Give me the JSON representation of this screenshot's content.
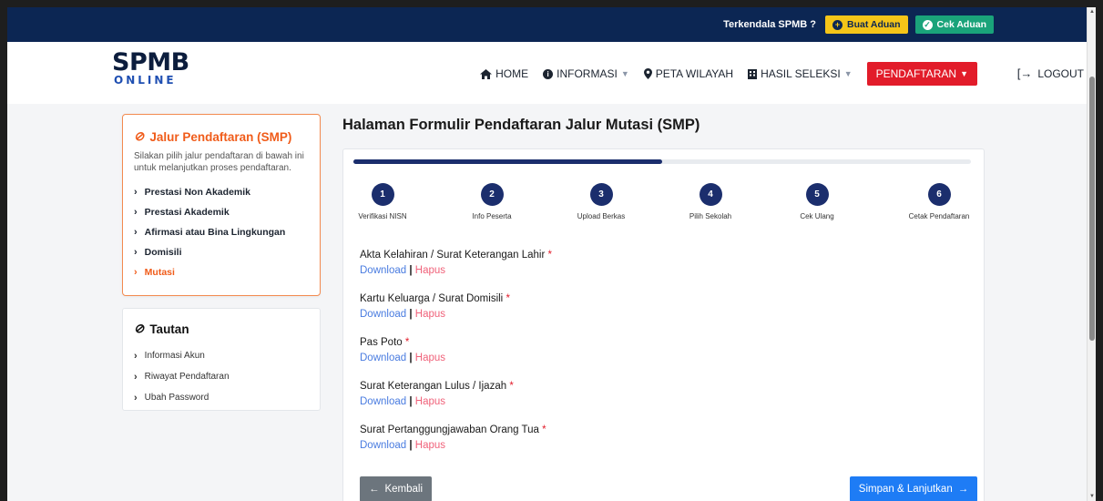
{
  "topbar": {
    "question": "Terkendala SPMB ?",
    "complain_button": "Buat Aduan",
    "check_button": "Cek Aduan"
  },
  "logo": {
    "line1": "SPMB",
    "line2": "ONLINE"
  },
  "menu": {
    "home": "HOME",
    "info": "INFORMASI",
    "map": "PETA WILAYAH",
    "result": "HASIL SELEKSI",
    "register": "PENDAFTARAN",
    "logout": "LOGOUT"
  },
  "sidebar": {
    "title": "Jalur Pendaftaran (SMP)",
    "description": "Silakan pilih jalur pendaftaran di bawah ini untuk melanjutkan proses pendaftaran.",
    "items": [
      {
        "label": "Prestasi Non Akademik"
      },
      {
        "label": "Prestasi Akademik"
      },
      {
        "label": "Afirmasi atau Bina Lingkungan"
      },
      {
        "label": "Domisili"
      },
      {
        "label": "Mutasi"
      }
    ]
  },
  "links_panel": {
    "title": "Tautan",
    "items": [
      {
        "label": "Informasi Akun"
      },
      {
        "label": "Riwayat Pendaftaran"
      },
      {
        "label": "Ubah Password"
      }
    ]
  },
  "page": {
    "title": "Halaman Formulir Pendaftaran Jalur Mutasi (SMP)"
  },
  "progress": {
    "fraction": 0.5
  },
  "steps": [
    {
      "num": "1",
      "label": "Verifikasi NISN"
    },
    {
      "num": "2",
      "label": "Info Peserta"
    },
    {
      "num": "3",
      "label": "Upload Berkas"
    },
    {
      "num": "4",
      "label": "Pilih Sekolah"
    },
    {
      "num": "5",
      "label": "Cek Ulang"
    },
    {
      "num": "6",
      "label": "Cetak Pendaftaran"
    }
  ],
  "documents": [
    {
      "name": "Akta Kelahiran / Surat Keterangan Lahir",
      "download": "Download",
      "delete": "Hapus"
    },
    {
      "name": "Kartu Keluarga / Surat Domisili",
      "download": "Download",
      "delete": "Hapus"
    },
    {
      "name": "Pas Poto",
      "download": "Download",
      "delete": "Hapus"
    },
    {
      "name": "Surat Keterangan Lulus / Ijazah",
      "download": "Download",
      "delete": "Hapus"
    },
    {
      "name": "Surat Pertanggungjawaban Orang Tua",
      "download": "Download",
      "delete": "Hapus"
    }
  ],
  "required_mark": "*",
  "separator": "|",
  "buttons": {
    "back": "Kembali",
    "next": "Simpan & Lanjutkan"
  }
}
